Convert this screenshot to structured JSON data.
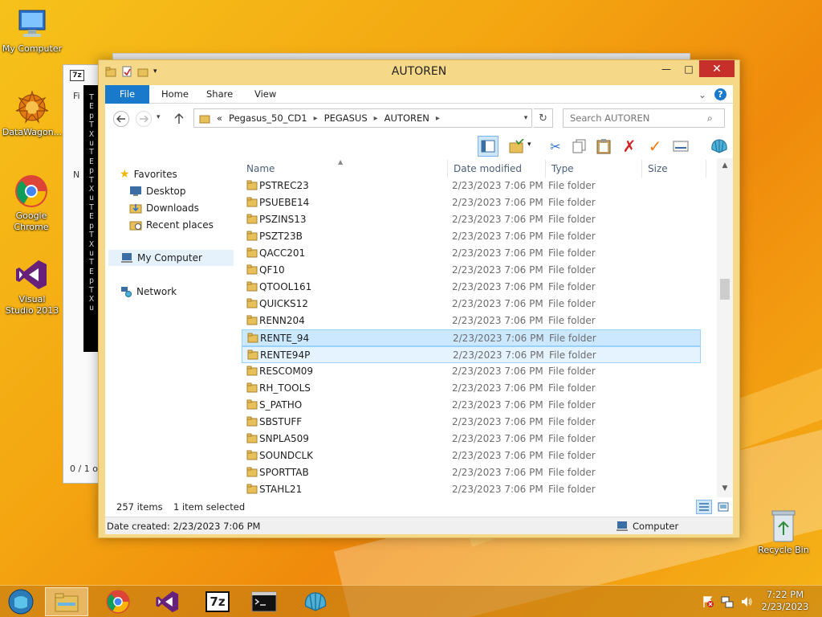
{
  "desktop": {
    "icons": [
      {
        "label": "My Computer"
      },
      {
        "label": "DataWagon..."
      },
      {
        "label": "Google Chrome"
      },
      {
        "label": "Visual Studio 2013"
      },
      {
        "label": "Recycle Bin"
      }
    ]
  },
  "background_windows": {
    "sevenzip": {
      "badge": "7z",
      "row_fi": "Fi",
      "row_n": "N",
      "status": "0 / 1 o"
    },
    "console": {
      "text": "TEpTXuTEpTXuTEpTXuTEpTXu"
    }
  },
  "window": {
    "title": "AUTOREN",
    "controls": {
      "minimize": "—",
      "maximize": "□",
      "close": "✕"
    }
  },
  "ribbon": {
    "tabs": [
      "File",
      "Home",
      "Share",
      "View"
    ],
    "collapse_glyph": "⌄",
    "help_glyph": "?"
  },
  "address": {
    "overflow": "«",
    "crumbs": [
      "Pegasus_50_CD1",
      "PEGASUS",
      "AUTOREN"
    ],
    "search_placeholder": "Search AUTOREN"
  },
  "nav": {
    "favorites": "Favorites",
    "desktop": "Desktop",
    "downloads": "Downloads",
    "recent": "Recent places",
    "computer": "My Computer",
    "network": "Network"
  },
  "columns": {
    "name": "Name",
    "date": "Date modified",
    "type": "Type",
    "size": "Size"
  },
  "files": [
    {
      "name": "PSTREC23",
      "date": "2/23/2023 7:06 PM",
      "type": "File folder"
    },
    {
      "name": "PSUEBE14",
      "date": "2/23/2023 7:06 PM",
      "type": "File folder"
    },
    {
      "name": "PSZINS13",
      "date": "2/23/2023 7:06 PM",
      "type": "File folder"
    },
    {
      "name": "PSZT23B",
      "date": "2/23/2023 7:06 PM",
      "type": "File folder"
    },
    {
      "name": "QACC201",
      "date": "2/23/2023 7:06 PM",
      "type": "File folder"
    },
    {
      "name": "QF10",
      "date": "2/23/2023 7:06 PM",
      "type": "File folder"
    },
    {
      "name": "QTOOL161",
      "date": "2/23/2023 7:06 PM",
      "type": "File folder"
    },
    {
      "name": "QUICKS12",
      "date": "2/23/2023 7:06 PM",
      "type": "File folder"
    },
    {
      "name": "RENN204",
      "date": "2/23/2023 7:06 PM",
      "type": "File folder"
    },
    {
      "name": "RENTE_94",
      "date": "2/23/2023 7:06 PM",
      "type": "File folder"
    },
    {
      "name": "RENTE94P",
      "date": "2/23/2023 7:06 PM",
      "type": "File folder"
    },
    {
      "name": "RESCOM09",
      "date": "2/23/2023 7:06 PM",
      "type": "File folder"
    },
    {
      "name": "RH_TOOLS",
      "date": "2/23/2023 7:06 PM",
      "type": "File folder"
    },
    {
      "name": "S_PATHO",
      "date": "2/23/2023 7:06 PM",
      "type": "File folder"
    },
    {
      "name": "SBSTUFF",
      "date": "2/23/2023 7:06 PM",
      "type": "File folder"
    },
    {
      "name": "SNPLA509",
      "date": "2/23/2023 7:06 PM",
      "type": "File folder"
    },
    {
      "name": "SOUNDCLK",
      "date": "2/23/2023 7:06 PM",
      "type": "File folder"
    },
    {
      "name": "SPORTTAB",
      "date": "2/23/2023 7:06 PM",
      "type": "File folder"
    },
    {
      "name": "STAHL21",
      "date": "2/23/2023 7:06 PM",
      "type": "File folder"
    }
  ],
  "selected_row": "RENTE_94",
  "hover_row": "RENTE94P",
  "status": {
    "count": "257 items",
    "selection": "1 item selected"
  },
  "details": {
    "created": "Date created: 2/23/2023 7:06 PM",
    "location": "Computer"
  },
  "taskbar": {
    "time": "7:22 PM",
    "date": "2/23/2023",
    "sevenzip_label": "7z"
  },
  "colors": {
    "accent": "#1979ca",
    "selection": "#cce8ff",
    "titlebar": "#f6d889",
    "close": "#c7302a"
  }
}
